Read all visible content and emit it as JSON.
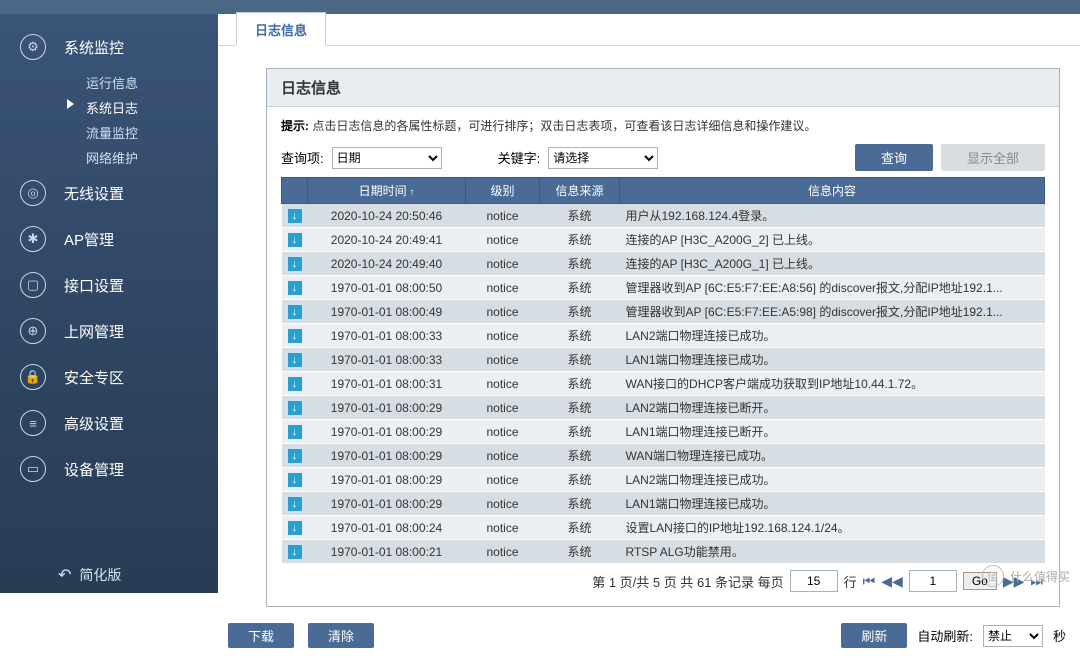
{
  "tab": "日志信息",
  "sidebar": {
    "items": [
      {
        "label": "系统监控",
        "icon": "⚙"
      },
      {
        "label": "无线设置",
        "icon": "◎"
      },
      {
        "label": "AP管理",
        "icon": "✱"
      },
      {
        "label": "接口设置",
        "icon": "▢"
      },
      {
        "label": "上网管理",
        "icon": "⊕"
      },
      {
        "label": "安全专区",
        "icon": "🔒"
      },
      {
        "label": "高级设置",
        "icon": "≡"
      },
      {
        "label": "设备管理",
        "icon": "▭"
      }
    ],
    "subs": [
      "运行信息",
      "系统日志",
      "流量监控",
      "网络维护"
    ],
    "simplify": "简化版"
  },
  "panel": {
    "title": "日志信息",
    "hint_label": "提示:",
    "hint": "点击日志信息的各属性标题，可进行排序；双击日志表项，可查看该日志详细信息和操作建议。",
    "query_label": "查询项:",
    "query_opt": "日期",
    "kw_label": "关键字:",
    "kw_opt": "请选择",
    "btn_query": "查询",
    "btn_all": "显示全部",
    "btn_download": "下载",
    "btn_clear": "清除",
    "btn_refresh": "刷新",
    "auto_label": "自动刷新:",
    "auto_opt": "禁止",
    "auto_unit": "秒"
  },
  "table": {
    "headers": [
      "",
      "日期时间",
      "级别",
      "信息来源",
      "信息内容"
    ],
    "rows": [
      [
        "2020-10-24 20:50:46",
        "notice",
        "系统",
        "用户从192.168.124.4登录。"
      ],
      [
        "2020-10-24 20:49:41",
        "notice",
        "系统",
        "连接的AP [H3C_A200G_2] 已上线。"
      ],
      [
        "2020-10-24 20:49:40",
        "notice",
        "系统",
        "连接的AP [H3C_A200G_1] 已上线。"
      ],
      [
        "1970-01-01 08:00:50",
        "notice",
        "系统",
        "管理器收到AP [6C:E5:F7:EE:A8:56] 的discover报文,分配IP地址192.1..."
      ],
      [
        "1970-01-01 08:00:49",
        "notice",
        "系统",
        "管理器收到AP [6C:E5:F7:EE:A5:98] 的discover报文,分配IP地址192.1..."
      ],
      [
        "1970-01-01 08:00:33",
        "notice",
        "系统",
        "LAN2端口物理连接已成功。"
      ],
      [
        "1970-01-01 08:00:33",
        "notice",
        "系统",
        "LAN1端口物理连接已成功。"
      ],
      [
        "1970-01-01 08:00:31",
        "notice",
        "系统",
        "WAN接口的DHCP客户端成功获取到IP地址10.44.1.72。"
      ],
      [
        "1970-01-01 08:00:29",
        "notice",
        "系统",
        "LAN2端口物理连接已断开。"
      ],
      [
        "1970-01-01 08:00:29",
        "notice",
        "系统",
        "LAN1端口物理连接已断开。"
      ],
      [
        "1970-01-01 08:00:29",
        "notice",
        "系统",
        "WAN端口物理连接已成功。"
      ],
      [
        "1970-01-01 08:00:29",
        "notice",
        "系统",
        "LAN2端口物理连接已成功。"
      ],
      [
        "1970-01-01 08:00:29",
        "notice",
        "系统",
        "LAN1端口物理连接已成功。"
      ],
      [
        "1970-01-01 08:00:24",
        "notice",
        "系统",
        "设置LAN接口的IP地址192.168.124.1/24。"
      ],
      [
        "1970-01-01 08:00:21",
        "notice",
        "系统",
        "RTSP ALG功能禁用。"
      ]
    ]
  },
  "pager": {
    "text1": "第 1 页/共 5 页  共 61 条记录  每页",
    "per_page": "15",
    "text2": "行",
    "page_input": "1",
    "go": "Go"
  },
  "watermark": "什么值得买"
}
